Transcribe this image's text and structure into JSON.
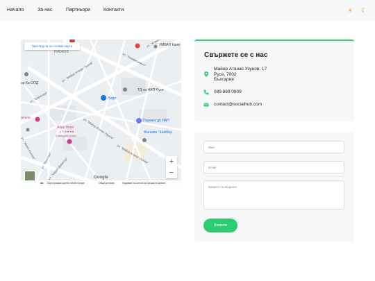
{
  "nav": {
    "items": [
      "Начало",
      "За нас",
      "Партньори",
      "Контакти"
    ],
    "light_icon": "sun-icon",
    "dark_icon": "moon-icon"
  },
  "map": {
    "view_larger": "Преглед на по-голяма карта",
    "labels": {
      "uimbal": "УМБАЛ Кани",
      "riokoz": "РИОКОЗ",
      "ka_ood": "ар Ка ООД",
      "nap": "ТД на НАП-Русе",
      "lidl": "Лидл",
      "parking": "Паркинг до НАП",
      "shop": "Магазин \"Шайбер",
      "atlas": "Atlas Hotel",
      "hotel_rating": "4.2 ★★★★",
      "hotel_type": "3-звезден хотел",
      "bochko": "ачъор"
    },
    "streets": {
      "s1": "ул. \"Майор Атанас Узунов\"",
      "s2": "ул. \"Майор Атанас Узунов\"",
      "s3": "ул. \"Независимост\"",
      "s4": "ул. \"Александровска\"",
      "s5": "ул. \"Борисова\"",
      "s6": "ул. \"Хаджи Димитър\"",
      "s7": "ул. \"Мостова\"",
      "s8": "ул. \"Ангел Кънчев\"",
      "s9": "ул. \"Майор Атанас Узунов\""
    },
    "zoom_in": "+",
    "zoom_out": "−",
    "google": "Google",
    "footer": {
      "keyboard": "⌨",
      "data": "Картографски данни ©2025 Google",
      "terms": "Общи условия",
      "report": "Подаване на сигнал за грешка в картата"
    }
  },
  "contact": {
    "title": "Свържете се с нас",
    "address_lines": [
      "Майор Атанас Узунов, 17",
      "Русе, 7002",
      "България"
    ],
    "phone": "089 999 0909",
    "email": "contact@socialhub.com",
    "icons": [
      "location-icon",
      "phone-icon",
      "email-icon"
    ],
    "accent": "#2ecc71"
  },
  "form": {
    "name_placeholder": "Име",
    "email_placeholder": "Email",
    "message_placeholder": "Вашето съобщение",
    "submit": "Изпрати"
  }
}
